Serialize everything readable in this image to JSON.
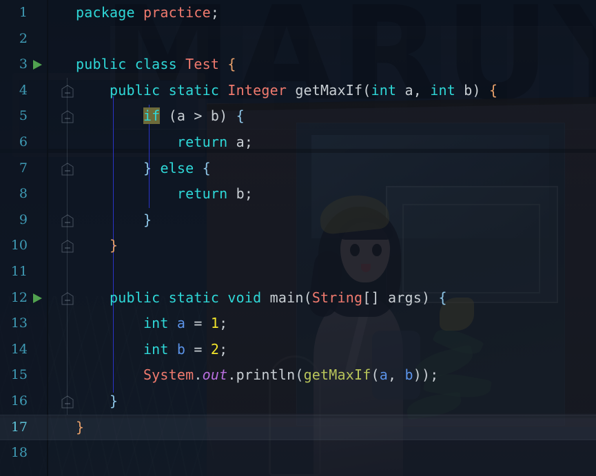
{
  "editor": {
    "name": "intellij-java-editor",
    "language": "Java",
    "background_text": "MARUYU",
    "theme_colors": {
      "editor_bg": "#0e1622",
      "gutter_bg": "#0e1622",
      "line_number": "#3f9bb5",
      "current_line_number": "#5ec3d8",
      "keyword": "#2fd8d8",
      "class_name": "#f07a6e",
      "identifier": "#c9cfd4",
      "method_call": "#b8c45a",
      "local_variable": "#5b93e8",
      "number": "#f2e52b",
      "static_field": "#b96fe0",
      "brace_outer": "#e8a06a",
      "brace_inner": "#8ec6e8",
      "selection": "#6d6b3a",
      "indent_guide": "#2a34c8",
      "run_marker": "#51a24f",
      "current_line_highlight": "rgba(190,205,225,0.075)"
    },
    "current_line": 17,
    "total_lines": 18,
    "selected_text": "if"
  },
  "lines": [
    {
      "n": "1",
      "indent": 0,
      "run": false,
      "fold": false,
      "text": "package practice;"
    },
    {
      "n": "2",
      "indent": 0,
      "run": false,
      "fold": false,
      "text": ""
    },
    {
      "n": "3",
      "indent": 0,
      "run": true,
      "fold": false,
      "text": "public class Test {"
    },
    {
      "n": "4",
      "indent": 0,
      "run": false,
      "fold": true,
      "text": "    public static Integer getMaxIf(int a, int b) {"
    },
    {
      "n": "5",
      "indent": 0,
      "run": false,
      "fold": true,
      "text": "        if (a > b) {"
    },
    {
      "n": "6",
      "indent": 0,
      "run": false,
      "fold": false,
      "text": "            return a;"
    },
    {
      "n": "7",
      "indent": 0,
      "run": false,
      "fold": true,
      "text": "        } else {"
    },
    {
      "n": "8",
      "indent": 0,
      "run": false,
      "fold": false,
      "text": "            return b;"
    },
    {
      "n": "9",
      "indent": 0,
      "run": false,
      "fold": true,
      "text": "        }"
    },
    {
      "n": "10",
      "indent": 0,
      "run": false,
      "fold": true,
      "text": "    }"
    },
    {
      "n": "11",
      "indent": 0,
      "run": false,
      "fold": false,
      "text": ""
    },
    {
      "n": "12",
      "indent": 0,
      "run": true,
      "fold": true,
      "text": "    public static void main(String[] args) {"
    },
    {
      "n": "13",
      "indent": 0,
      "run": false,
      "fold": false,
      "text": "        int a = 1;"
    },
    {
      "n": "14",
      "indent": 0,
      "run": false,
      "fold": false,
      "text": "        int b = 2;"
    },
    {
      "n": "15",
      "indent": 0,
      "run": false,
      "fold": false,
      "text": "        System.out.println(getMaxIf(a, b));"
    },
    {
      "n": "16",
      "indent": 0,
      "run": false,
      "fold": true,
      "text": "    }"
    },
    {
      "n": "17",
      "indent": 0,
      "run": false,
      "fold": false,
      "text": "}"
    },
    {
      "n": "18",
      "indent": 0,
      "run": false,
      "fold": false,
      "text": ""
    }
  ]
}
